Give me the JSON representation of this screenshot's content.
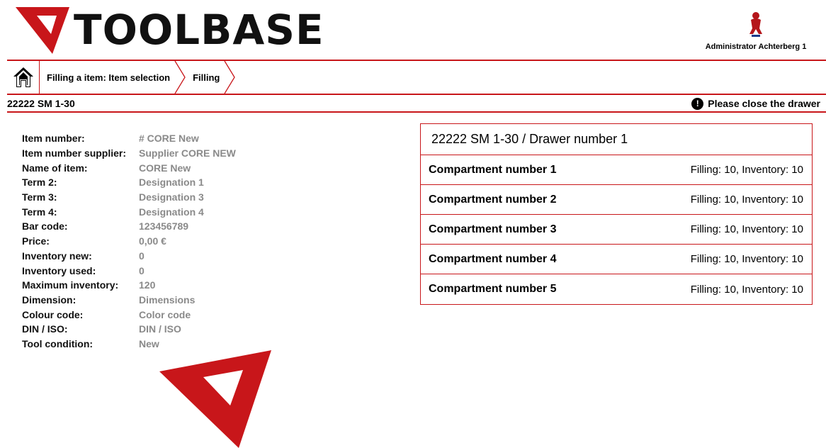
{
  "header": {
    "logo_text": "TOOLBASE",
    "user_name": "Administrator Achterberg 1"
  },
  "breadcrumb": {
    "items": [
      {
        "label": "Filling a item: Item selection"
      },
      {
        "label": "Filling"
      }
    ]
  },
  "subbar": {
    "title": "22222 SM 1-30",
    "alert": "Please close the drawer"
  },
  "item": {
    "fields": [
      {
        "label": "Item number:",
        "value": "# CORE New"
      },
      {
        "label": "Item number supplier:",
        "value": "Supplier CORE NEW"
      },
      {
        "label": "Name of item:",
        "value": "CORE New"
      },
      {
        "label": "Term 2:",
        "value": "Designation 1"
      },
      {
        "label": "Term 3:",
        "value": "Designation 3"
      },
      {
        "label": "Term 4:",
        "value": "Designation 4"
      },
      {
        "label": "Bar code:",
        "value": "123456789"
      },
      {
        "label": "Price:",
        "value": "0,00 €"
      },
      {
        "label": "Inventory new:",
        "value": "0"
      },
      {
        "label": "Inventory used:",
        "value": "0"
      },
      {
        "label": "Maximum inventory:",
        "value": "120"
      },
      {
        "label": "Dimension:",
        "value": "Dimensions"
      },
      {
        "label": "Colour code:",
        "value": "Color code"
      },
      {
        "label": "DIN / ISO:",
        "value": "DIN / ISO"
      },
      {
        "label": "Tool condition:",
        "value": "New"
      }
    ]
  },
  "drawer": {
    "title": "22222 SM 1-30 / Drawer number 1",
    "compartments": [
      {
        "name": "Compartment number 1",
        "info": "Filling: 10, Inventory: 10"
      },
      {
        "name": "Compartment number 2",
        "info": "Filling: 10, Inventory: 10"
      },
      {
        "name": "Compartment number 3",
        "info": "Filling: 10, Inventory: 10"
      },
      {
        "name": "Compartment number 4",
        "info": "Filling: 10, Inventory: 10"
      },
      {
        "name": "Compartment number 5",
        "info": "Filling: 10, Inventory: 10"
      }
    ]
  },
  "colors": {
    "brand_red": "#c8161a",
    "value_grey": "#8a8a8a"
  },
  "icons": {
    "home": "home-icon",
    "alert": "exclamation-icon",
    "avatar": "user-avatar-icon"
  }
}
